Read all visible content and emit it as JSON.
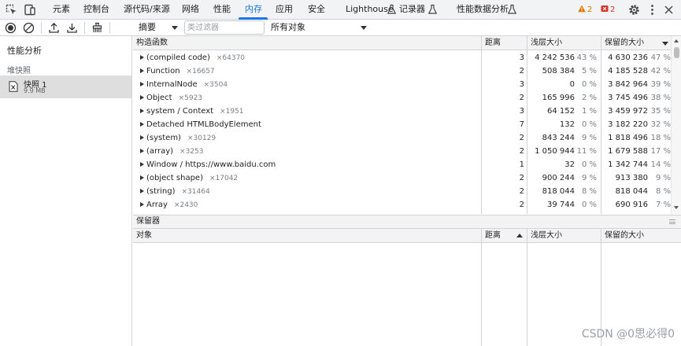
{
  "tabs": [
    {
      "label": "元素"
    },
    {
      "label": "控制台"
    },
    {
      "label": "源代码/来源"
    },
    {
      "label": "网络"
    },
    {
      "label": "性能"
    },
    {
      "label": "内存"
    },
    {
      "label": "应用"
    },
    {
      "label": "安全"
    },
    {
      "label": "Lighthouse"
    },
    {
      "label": "记录器"
    },
    {
      "label": "性能数据分析"
    }
  ],
  "active_tab": "内存",
  "warnings_count": "2",
  "errors_count": "2",
  "toolbar": {
    "view_select": "摘要",
    "filter_placeholder": "类过滤器",
    "objects_select": "所有对象"
  },
  "sidebar": {
    "title": "性能分析",
    "section": "堆快照",
    "snapshot": {
      "name": "快照 1",
      "size": "9.9 MB"
    }
  },
  "grid": {
    "headers": {
      "constructor": "构造函数",
      "distance": "距离",
      "shallow": "浅层大小",
      "retained": "保留的大小"
    },
    "rows": [
      {
        "name": "(compiled code)",
        "count": "×64370",
        "distance": "3",
        "shallow": "4 242 536",
        "shallow_pct": "43 %",
        "retained": "4 630 236",
        "retained_pct": "47 %"
      },
      {
        "name": "Function",
        "count": "×16657",
        "distance": "2",
        "shallow": "508 384",
        "shallow_pct": "5 %",
        "retained": "4 185 528",
        "retained_pct": "42 %"
      },
      {
        "name": "InternalNode",
        "count": "×3504",
        "distance": "3",
        "shallow": "0",
        "shallow_pct": "0 %",
        "retained": "3 842 964",
        "retained_pct": "39 %"
      },
      {
        "name": "Object",
        "count": "×5923",
        "distance": "2",
        "shallow": "165 996",
        "shallow_pct": "2 %",
        "retained": "3 745 496",
        "retained_pct": "38 %"
      },
      {
        "name": "system / Context",
        "count": "×1951",
        "distance": "3",
        "shallow": "64 152",
        "shallow_pct": "1 %",
        "retained": "3 459 972",
        "retained_pct": "35 %"
      },
      {
        "name": "Detached HTMLBodyElement",
        "count": "",
        "distance": "7",
        "shallow": "132",
        "shallow_pct": "0 %",
        "retained": "3 182 220",
        "retained_pct": "32 %"
      },
      {
        "name": "(system)",
        "count": "×30129",
        "distance": "2",
        "shallow": "843 244",
        "shallow_pct": "9 %",
        "retained": "1 818 496",
        "retained_pct": "18 %"
      },
      {
        "name": "(array)",
        "count": "×3253",
        "distance": "2",
        "shallow": "1 050 944",
        "shallow_pct": "11 %",
        "retained": "1 679 588",
        "retained_pct": "17 %"
      },
      {
        "name": "Window / https://www.baidu.com",
        "count": "",
        "distance": "1",
        "shallow": "32",
        "shallow_pct": "0 %",
        "retained": "1 342 744",
        "retained_pct": "14 %"
      },
      {
        "name": "(object shape)",
        "count": "×17042",
        "distance": "2",
        "shallow": "900 244",
        "shallow_pct": "9 %",
        "retained": "913 380",
        "retained_pct": "9 %"
      },
      {
        "name": "(string)",
        "count": "×31464",
        "distance": "2",
        "shallow": "818 044",
        "shallow_pct": "8 %",
        "retained": "818 044",
        "retained_pct": "8 %"
      },
      {
        "name": "Array",
        "count": "×2430",
        "distance": "2",
        "shallow": "39 744",
        "shallow_pct": "0 %",
        "retained": "690 916",
        "retained_pct": "7 %"
      }
    ]
  },
  "retainers": {
    "title": "保留器",
    "headers": {
      "object": "对象",
      "distance": "距离",
      "shallow": "浅层大小",
      "retained": "保留的大小"
    }
  },
  "watermark": "CSDN @0思必得0",
  "colors": {
    "accent": "#1a73e8",
    "warning": "#e37400",
    "error": "#d93025",
    "selected_row": "#dedede"
  },
  "icons": [
    "inspect-icon",
    "device-toolbar-icon",
    "lighthouse-flask-icon",
    "recorder-flask-icon",
    "perf-insights-flask-icon",
    "warning-icon",
    "error-icon",
    "settings-gear-icon",
    "more-menu-icon",
    "close-icon",
    "record-icon",
    "clear-icon",
    "load-profile-icon",
    "save-profile-icon",
    "garbage-collect-icon",
    "heap-snapshot-icon"
  ]
}
